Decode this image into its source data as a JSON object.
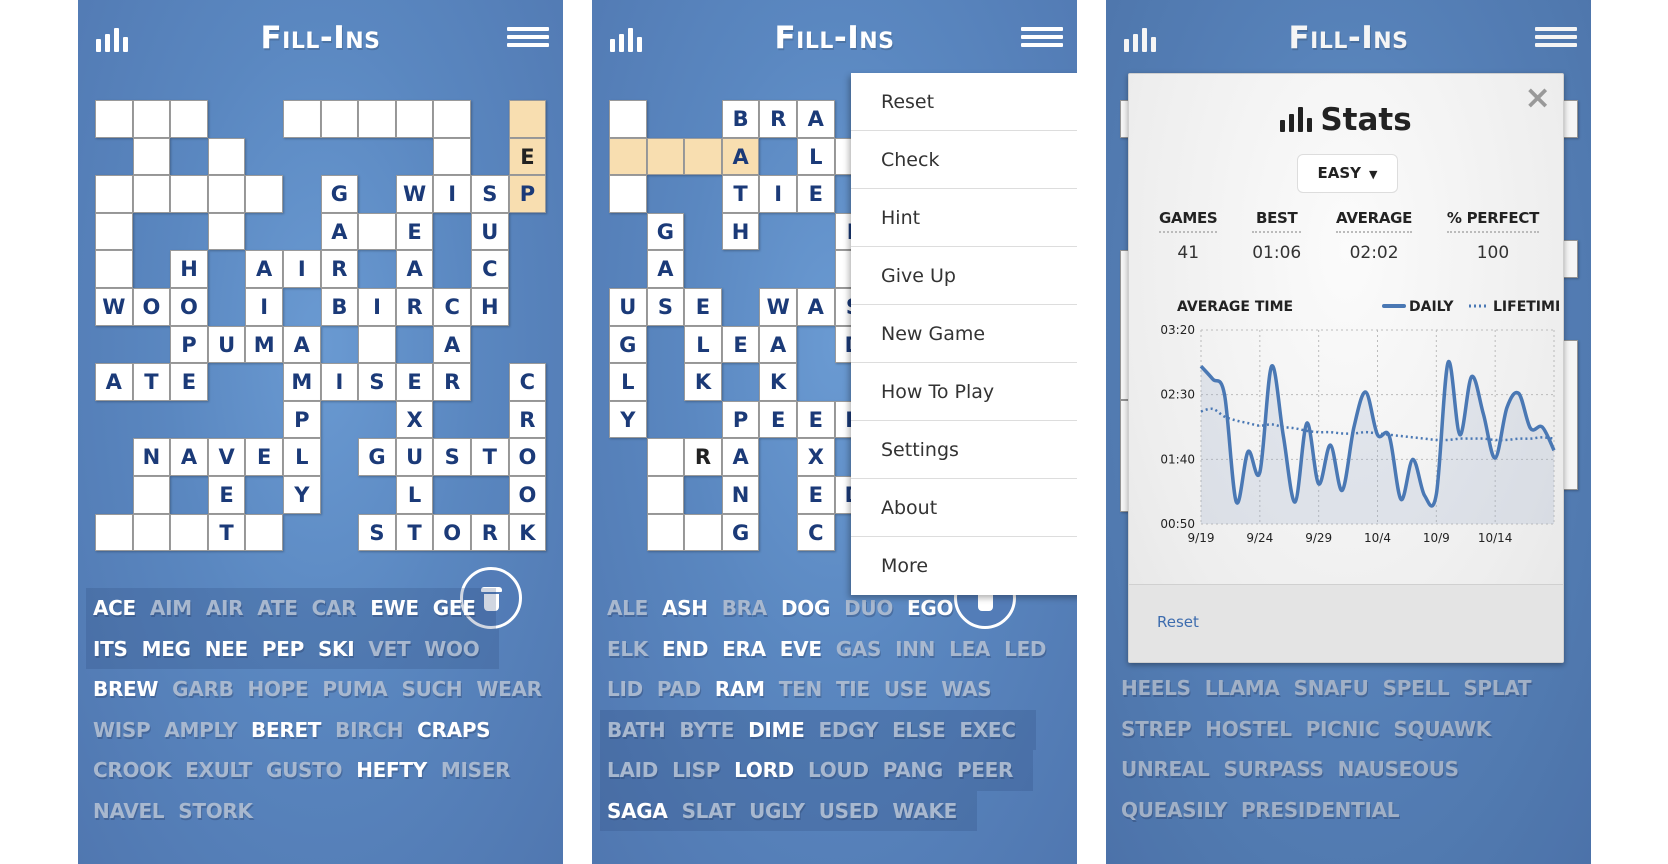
{
  "app": {
    "title": "Fill-Ins",
    "colors": {
      "background": "#5a87c0",
      "cell": "#ffffff",
      "highlight": "#f8deb0",
      "letter": "#1b3a78",
      "user_letter": "#222222",
      "word_available": "#ffffff",
      "word_used": "#a8b8cf",
      "chart_line": "#4a78b4"
    }
  },
  "panels": [
    {
      "id": "panel1",
      "grid": [
        [
          0,
          0,
          ""
        ],
        [
          1,
          0,
          ""
        ],
        [
          2,
          0,
          ""
        ],
        [
          5,
          0,
          ""
        ],
        [
          6,
          0,
          ""
        ],
        [
          7,
          0,
          ""
        ],
        [
          8,
          0,
          ""
        ],
        [
          9,
          0,
          ""
        ],
        [
          11,
          0,
          "",
          "hl"
        ],
        [
          1,
          1,
          ""
        ],
        [
          3,
          1,
          ""
        ],
        [
          9,
          1,
          ""
        ],
        [
          11,
          1,
          "E",
          "hl-user"
        ],
        [
          0,
          2,
          ""
        ],
        [
          1,
          2,
          ""
        ],
        [
          2,
          2,
          ""
        ],
        [
          3,
          2,
          ""
        ],
        [
          4,
          2,
          ""
        ],
        [
          6,
          2,
          "G"
        ],
        [
          8,
          2,
          "W"
        ],
        [
          9,
          2,
          "I"
        ],
        [
          10,
          2,
          "S"
        ],
        [
          11,
          2,
          "P",
          "hl"
        ],
        [
          0,
          3,
          ""
        ],
        [
          3,
          3,
          ""
        ],
        [
          6,
          3,
          "A"
        ],
        [
          7,
          3,
          ""
        ],
        [
          8,
          3,
          "E"
        ],
        [
          10,
          3,
          "U"
        ],
        [
          0,
          4,
          ""
        ],
        [
          2,
          4,
          "H"
        ],
        [
          4,
          4,
          "A"
        ],
        [
          5,
          4,
          "I"
        ],
        [
          6,
          4,
          "R"
        ],
        [
          8,
          4,
          "A"
        ],
        [
          10,
          4,
          "C"
        ],
        [
          0,
          5,
          "W"
        ],
        [
          1,
          5,
          "O"
        ],
        [
          2,
          5,
          "O"
        ],
        [
          4,
          5,
          "I"
        ],
        [
          6,
          5,
          "B"
        ],
        [
          7,
          5,
          "I"
        ],
        [
          8,
          5,
          "R"
        ],
        [
          9,
          5,
          "C"
        ],
        [
          10,
          5,
          "H"
        ],
        [
          2,
          6,
          "P"
        ],
        [
          3,
          6,
          "U"
        ],
        [
          4,
          6,
          "M"
        ],
        [
          5,
          6,
          "A"
        ],
        [
          7,
          6,
          ""
        ],
        [
          9,
          6,
          "A"
        ],
        [
          0,
          7,
          "A"
        ],
        [
          1,
          7,
          "T"
        ],
        [
          2,
          7,
          "E"
        ],
        [
          5,
          7,
          "M"
        ],
        [
          6,
          7,
          "I"
        ],
        [
          7,
          7,
          "S"
        ],
        [
          8,
          7,
          "E"
        ],
        [
          9,
          7,
          "R"
        ],
        [
          11,
          7,
          "C"
        ],
        [
          5,
          8,
          "P"
        ],
        [
          8,
          8,
          "X"
        ],
        [
          11,
          8,
          "R"
        ],
        [
          1,
          9,
          "N"
        ],
        [
          2,
          9,
          "A"
        ],
        [
          3,
          9,
          "V"
        ],
        [
          4,
          9,
          "E"
        ],
        [
          5,
          9,
          "L"
        ],
        [
          7,
          9,
          "G"
        ],
        [
          8,
          9,
          "U"
        ],
        [
          9,
          9,
          "S"
        ],
        [
          10,
          9,
          "T"
        ],
        [
          11,
          9,
          "O"
        ],
        [
          1,
          10,
          ""
        ],
        [
          3,
          10,
          "E"
        ],
        [
          5,
          10,
          "Y"
        ],
        [
          8,
          10,
          "L"
        ],
        [
          11,
          10,
          "O"
        ],
        [
          0,
          11,
          ""
        ],
        [
          1,
          11,
          ""
        ],
        [
          2,
          11,
          ""
        ],
        [
          3,
          11,
          "T"
        ],
        [
          4,
          11,
          ""
        ],
        [
          7,
          11,
          "S"
        ],
        [
          8,
          11,
          "T"
        ],
        [
          9,
          11,
          "O"
        ],
        [
          10,
          11,
          "R"
        ],
        [
          11,
          11,
          "K"
        ]
      ],
      "word_rows": [
        {
          "bg": true,
          "words": [
            [
              "ACE",
              1
            ],
            [
              "AIM",
              0
            ],
            [
              "AIR",
              0
            ],
            [
              "ATE",
              0
            ],
            [
              "CAR",
              0
            ],
            [
              "EWE",
              1
            ],
            [
              "GEE",
              1
            ]
          ]
        },
        {
          "bg": true,
          "words": [
            [
              "ITS",
              1
            ],
            [
              "MEG",
              1
            ],
            [
              "NEE",
              1
            ],
            [
              "PEP",
              1
            ],
            [
              "SKI",
              1
            ],
            [
              "VET",
              0
            ],
            [
              "WOO",
              0
            ]
          ]
        },
        {
          "bg": false,
          "words": [
            [
              "BREW",
              1
            ],
            [
              "GARB",
              0
            ],
            [
              "HOPE",
              0
            ],
            [
              "PUMA",
              0
            ],
            [
              "SUCH",
              0
            ],
            [
              "WEAR",
              0
            ]
          ]
        },
        {
          "bg": false,
          "words": [
            [
              "WISP",
              0
            ],
            [
              "AMPLY",
              0
            ],
            [
              "BERET",
              1
            ],
            [
              "BIRCH",
              0
            ],
            [
              "CRAPS",
              1
            ]
          ]
        },
        {
          "bg": false,
          "words": [
            [
              "CROOK",
              0
            ],
            [
              "EXULT",
              0
            ],
            [
              "GUSTO",
              0
            ],
            [
              "HEFTY",
              1
            ],
            [
              "MISER",
              0
            ]
          ]
        },
        {
          "bg": false,
          "words": [
            [
              "NAVEL",
              0
            ],
            [
              "STORK",
              0
            ]
          ]
        }
      ]
    },
    {
      "id": "panel2",
      "grid": [
        [
          0,
          0,
          ""
        ],
        [
          3,
          0,
          "B"
        ],
        [
          4,
          0,
          "R"
        ],
        [
          5,
          0,
          "A"
        ],
        [
          0,
          1,
          "",
          "hl"
        ],
        [
          1,
          1,
          "",
          "hl"
        ],
        [
          2,
          1,
          "",
          "hl"
        ],
        [
          3,
          1,
          "A",
          "hl"
        ],
        [
          5,
          1,
          "L"
        ],
        [
          6,
          1,
          ""
        ],
        [
          0,
          2,
          ""
        ],
        [
          3,
          2,
          "T"
        ],
        [
          4,
          2,
          "I"
        ],
        [
          5,
          2,
          "E"
        ],
        [
          1,
          3,
          "G"
        ],
        [
          3,
          3,
          "H"
        ],
        [
          6,
          3,
          "L"
        ],
        [
          1,
          4,
          "A"
        ],
        [
          6,
          4,
          ""
        ],
        [
          0,
          5,
          "U"
        ],
        [
          1,
          5,
          "S"
        ],
        [
          2,
          5,
          "E"
        ],
        [
          4,
          5,
          "W"
        ],
        [
          5,
          5,
          "A"
        ],
        [
          6,
          5,
          "S"
        ],
        [
          0,
          6,
          "G"
        ],
        [
          2,
          6,
          "L"
        ],
        [
          3,
          6,
          "E"
        ],
        [
          4,
          6,
          "A"
        ],
        [
          6,
          6,
          "D"
        ],
        [
          0,
          7,
          "L"
        ],
        [
          2,
          7,
          "K"
        ],
        [
          4,
          7,
          "K"
        ],
        [
          0,
          8,
          "Y"
        ],
        [
          3,
          8,
          "P"
        ],
        [
          4,
          8,
          "E"
        ],
        [
          5,
          8,
          "E"
        ],
        [
          6,
          8,
          "R"
        ],
        [
          1,
          9,
          ""
        ],
        [
          2,
          9,
          "R",
          "user"
        ],
        [
          3,
          9,
          "A"
        ],
        [
          5,
          9,
          "X"
        ],
        [
          1,
          10,
          ""
        ],
        [
          3,
          10,
          "N"
        ],
        [
          5,
          10,
          "E"
        ],
        [
          6,
          10,
          "D"
        ],
        [
          1,
          11,
          ""
        ],
        [
          2,
          11,
          ""
        ],
        [
          3,
          11,
          "G"
        ],
        [
          5,
          11,
          "C"
        ]
      ],
      "menu": {
        "items": [
          "Reset",
          "Check",
          "Hint",
          "Give Up",
          "New Game",
          "How To Play",
          "Settings",
          "About",
          "More"
        ]
      },
      "word_rows": [
        {
          "bg": false,
          "words": [
            [
              "ALE",
              0
            ],
            [
              "ASH",
              1
            ],
            [
              "BRA",
              0
            ],
            [
              "DOG",
              1
            ],
            [
              "DUO",
              0
            ],
            [
              "EGO",
              1
            ]
          ]
        },
        {
          "bg": false,
          "words": [
            [
              "ELK",
              0
            ],
            [
              "END",
              1
            ],
            [
              "ERA",
              1
            ],
            [
              "EVE",
              1
            ],
            [
              "GAS",
              0
            ],
            [
              "INN",
              0
            ],
            [
              "LEA",
              0
            ],
            [
              "LED",
              0
            ]
          ]
        },
        {
          "bg": false,
          "words": [
            [
              "LID",
              0
            ],
            [
              "PAD",
              0
            ],
            [
              "RAM",
              1
            ],
            [
              "TEN",
              0
            ],
            [
              "TIE",
              0
            ],
            [
              "USE",
              0
            ],
            [
              "WAS",
              0
            ]
          ]
        },
        {
          "bg": true,
          "words": [
            [
              "BATH",
              0
            ],
            [
              "BYTE",
              0
            ],
            [
              "DIME",
              1
            ],
            [
              "EDGY",
              0
            ],
            [
              "ELSE",
              0
            ],
            [
              "EXEC",
              0
            ]
          ]
        },
        {
          "bg": true,
          "words": [
            [
              "LAID",
              0
            ],
            [
              "LISP",
              0
            ],
            [
              "LORD",
              1
            ],
            [
              "LOUD",
              0
            ],
            [
              "PANG",
              0
            ],
            [
              "PEER",
              0
            ]
          ]
        },
        {
          "bg": true,
          "words": [
            [
              "SAGA",
              1
            ],
            [
              "SLAT",
              0
            ],
            [
              "UGLY",
              0
            ],
            [
              "USED",
              0
            ],
            [
              "WAKE",
              0
            ]
          ]
        }
      ]
    },
    {
      "id": "panel3",
      "word_rows": [
        {
          "bg": false,
          "words": [
            [
              "HEELS",
              0
            ],
            [
              "LLAMA",
              0
            ],
            [
              "SNAFU",
              0
            ],
            [
              "SPELL",
              0
            ],
            [
              "SPLAT",
              0
            ]
          ]
        },
        {
          "bg": false,
          "words": [
            [
              "STREP",
              0
            ],
            [
              "HOSTEL",
              0
            ],
            [
              "PICNIC",
              0
            ],
            [
              "SQUAWK",
              0
            ]
          ]
        },
        {
          "bg": false,
          "words": [
            [
              "UNREAL",
              0
            ],
            [
              "SURPASS",
              0
            ],
            [
              "NAUSEOUS",
              0
            ]
          ]
        },
        {
          "bg": false,
          "words": [
            [
              "QUEASILY",
              0
            ],
            [
              "PRESIDENTIAL",
              0
            ]
          ]
        }
      ],
      "stats": {
        "title": "Stats",
        "close_icon": "×",
        "difficulty": "EASY",
        "difficulty_arrow": "▼",
        "columns": [
          {
            "label": "GAMES",
            "value": "41"
          },
          {
            "label": "BEST",
            "value": "01:06"
          },
          {
            "label": "AVERAGE",
            "value": "02:02"
          },
          {
            "label": "% PERFECT",
            "value": "100"
          }
        ],
        "reset_label": "Reset"
      }
    }
  ],
  "chart_data": {
    "type": "line",
    "title": "AVERAGE TIME",
    "xlabel": "",
    "ylabel": "",
    "x_start_date": "9/19",
    "x_days": [
      0,
      1,
      2,
      3,
      4,
      5,
      6,
      7,
      8,
      9,
      10,
      11,
      12,
      13,
      14,
      15,
      16,
      17,
      18,
      19,
      20,
      21,
      22,
      23,
      24,
      25,
      26,
      27,
      28,
      29,
      30
    ],
    "x_ticks": [
      {
        "day": 0,
        "label": "9/19"
      },
      {
        "day": 5,
        "label": "9/24"
      },
      {
        "day": 10,
        "label": "9/29"
      },
      {
        "day": 15,
        "label": "10/4"
      },
      {
        "day": 20,
        "label": "10/9"
      },
      {
        "day": 25,
        "label": "10/14"
      }
    ],
    "y_ticks": [
      {
        "value": 200,
        "label": "03:20"
      },
      {
        "value": 150,
        "label": "02:30"
      },
      {
        "value": 100,
        "label": "01:40"
      },
      {
        "value": 50,
        "label": "00:50"
      }
    ],
    "ylim": [
      50,
      200
    ],
    "xlim": [
      0,
      30
    ],
    "y_units": "seconds",
    "grid": true,
    "legend": "top-right",
    "series": [
      {
        "name": "DAILY",
        "style": "solid",
        "values": [
          172,
          162,
          150,
          67,
          106,
          90,
          172,
          118,
          67,
          128,
          81,
          111,
          76,
          125,
          152,
          119,
          118,
          69,
          100,
          72,
          73,
          175,
          119,
          164,
          135,
          101,
          140,
          151,
          124,
          125,
          107
        ]
      },
      {
        "name": "LIFETIME",
        "style": "dotted",
        "values": [
          137,
          139,
          133,
          130,
          128,
          126,
          127,
          125,
          124,
          122,
          121,
          121,
          120,
          120,
          121,
          120,
          119,
          118,
          117,
          116,
          115,
          115,
          116,
          116,
          116,
          115,
          115,
          116,
          116,
          117,
          116
        ]
      }
    ]
  }
}
